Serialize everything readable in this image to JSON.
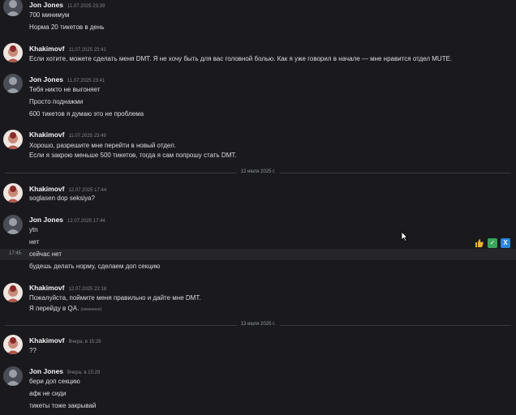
{
  "date_dividers": [
    "12 июля 2025 г.",
    "13 июля 2025 г."
  ],
  "hover": {
    "time": "17:45"
  },
  "reactions": [
    "thumbs-up",
    "check",
    "cross"
  ],
  "reaction_symbols": {
    "check": "✓",
    "cross": "X"
  },
  "colors": {
    "background": "#1a1a1e",
    "check": "#3ba55c",
    "cross": "#2c83e3",
    "thumbs": "#f0b232"
  },
  "messages": [
    {
      "author": "Jon Jones",
      "timestamp": "11.07.2025 23:39",
      "lines": [
        "700 минимум",
        "Норма 20 тикетов в день"
      ]
    },
    {
      "author": "Khakimovf",
      "timestamp": "11.07.2025 23:41",
      "lines": [
        "Если хотите, можете сделать меня DMT. Я не хочу быть для вас головной болью. Как я уже говорил в начале — мне нравится отдел MUTE."
      ]
    },
    {
      "author": "Jon Jones",
      "timestamp": "11.07.2025 23:41",
      "lines": [
        "Тебя никто не выгоняет",
        "Просто поднажми",
        "600 тикетов я думаю это не проблема"
      ]
    },
    {
      "author": "Khakimovf",
      "timestamp": "11.07.2025 23:49",
      "lines": [
        "Хорошо, разрешите мне перейти в новый отдел.",
        "Если я закрою меньше 500 тикетов, тогда я сам попрошу стать DMT."
      ]
    },
    {
      "author": "Khakimovf",
      "timestamp": "12.07.2025 17:44",
      "lines": [
        "soglasen  dop seksiya?"
      ]
    },
    {
      "author": "Jon Jones",
      "timestamp": "12.07.2025 17:44",
      "lines": [
        "ytn",
        "нет",
        "сейчас нет",
        "будешь делать норму, сделаем доп секцию"
      ]
    },
    {
      "author": "Khakimovf",
      "timestamp": "12.07.2025 22:18",
      "lines": [
        "Пожалуйста, поймите меня правильно и дайте мне   DMT.",
        "Я перейду в QA."
      ],
      "edited": "(изменено)"
    },
    {
      "author": "Khakimovf",
      "timestamp": "Вчера, в 15:29",
      "lines": [
        "??"
      ]
    },
    {
      "author": "Jon Jones",
      "timestamp": "Вчера, в 15:29",
      "lines": [
        "бери доп секцию",
        "афк не сиди",
        "тикеты тоже закрывай"
      ]
    }
  ]
}
